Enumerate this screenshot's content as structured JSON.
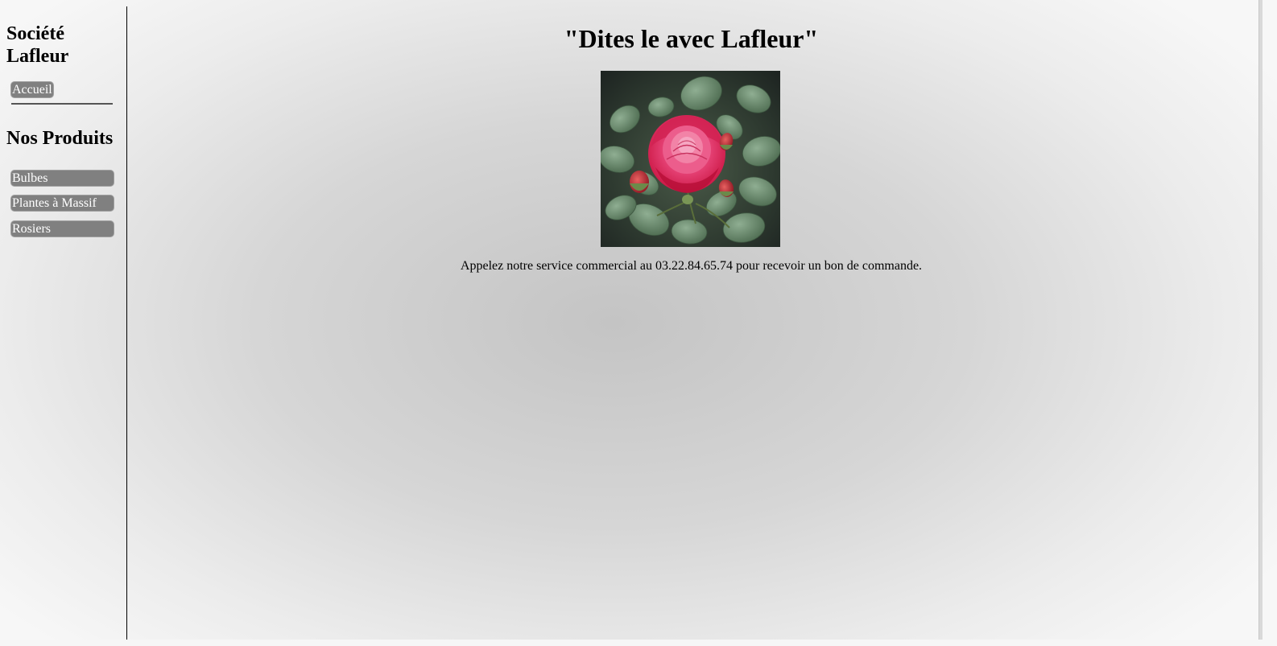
{
  "sidebar": {
    "site_title": "Société Lafleur",
    "home_label": "Accueil",
    "section_title": "Nos Produits",
    "products": [
      {
        "label": "Bulbes"
      },
      {
        "label": "Plantes à Massif"
      },
      {
        "label": "Rosiers"
      }
    ]
  },
  "main": {
    "headline": "\"Dites le avec Lafleur\"",
    "image": "red-rose-photo",
    "callout": "Appelez notre service commercial au 03.22.84.65.74 pour recevoir un bon de commande."
  },
  "colors": {
    "nav_button_bg": "#808080",
    "nav_button_text": "#ffffff",
    "rose": "#e0305a",
    "foliage": "#5b7a5e"
  }
}
